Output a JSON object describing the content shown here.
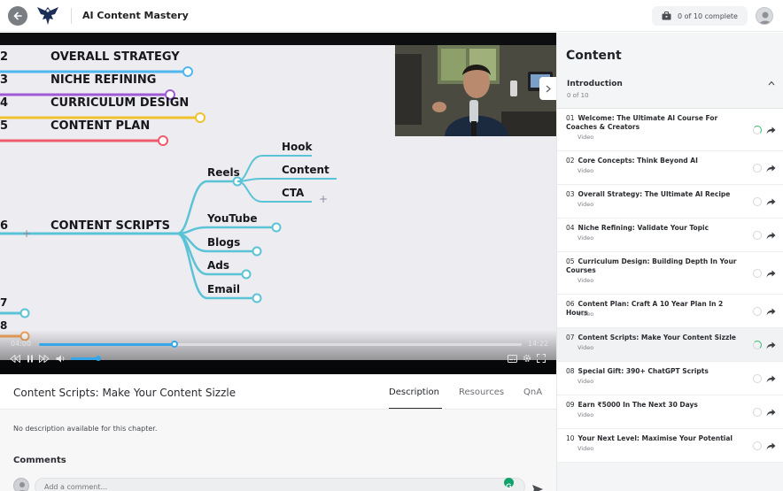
{
  "header": {
    "back_icon": "arrow-left-icon",
    "logo_icon": "eagle-logo-icon",
    "app_title": "AI Content Mastery",
    "progress_icon": "briefcase-icon",
    "progress_text": "0 of 10 complete",
    "avatar_icon": "user-avatar-icon"
  },
  "video": {
    "mindmap": {
      "top_items": [
        {
          "num": "2",
          "label": "OVERALL STRATEGY",
          "color": "#4fb6ef"
        },
        {
          "num": "3",
          "label": "NICHE REFINING",
          "color": "#a05ad6"
        },
        {
          "num": "4",
          "label": "CURRICULUM DESIGN",
          "color": "#f2c12e"
        },
        {
          "num": "5",
          "label": "CONTENT PLAN",
          "color": "#ef5b6c"
        }
      ],
      "center_num": "6",
      "center_label": "CONTENT SCRIPTS",
      "branches": [
        "Reels",
        "YouTube",
        "Blogs",
        "Ads",
        "Email"
      ],
      "reels_children": [
        "Hook",
        "Content",
        "CTA"
      ],
      "bottom_items": [
        {
          "num": "7"
        },
        {
          "num": "8"
        }
      ]
    },
    "current_time": "04:00",
    "duration": "14:22",
    "progress_fraction": 0.28,
    "volume_fraction": 0.95,
    "accent_color": "#35a7e8"
  },
  "lesson": {
    "title": "Content Scripts: Make Your Content Sizzle",
    "tabs": [
      "Description",
      "Resources",
      "QnA"
    ],
    "active_tab": "Description",
    "description": "No description available for this chapter.",
    "comments_heading": "Comments",
    "comment_placeholder": "Add a comment..."
  },
  "sidebar": {
    "title": "Content",
    "section": {
      "title": "Introduction",
      "count": "0 of 10"
    },
    "chapters": [
      {
        "num": "01",
        "title": "Welcome: The Ultimate AI Course For Coaches & Creators",
        "type": "Video",
        "status": "in-progress"
      },
      {
        "num": "02",
        "title": "Core Concepts: Think Beyond AI",
        "type": "Video",
        "status": "not-started"
      },
      {
        "num": "03",
        "title": "Overall Strategy: The Ultimate AI Recipe",
        "type": "Video",
        "status": "not-started"
      },
      {
        "num": "04",
        "title": "Niche Refining: Validate Your Topic",
        "type": "Video",
        "status": "not-started"
      },
      {
        "num": "05",
        "title": "Curriculum Design: Building Depth In Your Courses",
        "type": "Video",
        "status": "not-started"
      },
      {
        "num": "06",
        "title": "Content Plan: Craft A 10 Year Plan In 2 Hours",
        "type": "Video",
        "status": "not-started"
      },
      {
        "num": "07",
        "title": "Content Scripts: Make Your Content Sizzle",
        "type": "Video",
        "status": "in-progress"
      },
      {
        "num": "08",
        "title": "Special Gift: 390+ ChatGPT Scripts",
        "type": "Video",
        "status": "not-started"
      },
      {
        "num": "09",
        "title": "Earn ₹5000 In The Next 30 Days",
        "type": "Video",
        "status": "not-started"
      },
      {
        "num": "10",
        "title": "Your Next Level: Maximise Your Potential",
        "type": "Video",
        "status": "not-started"
      }
    ]
  }
}
